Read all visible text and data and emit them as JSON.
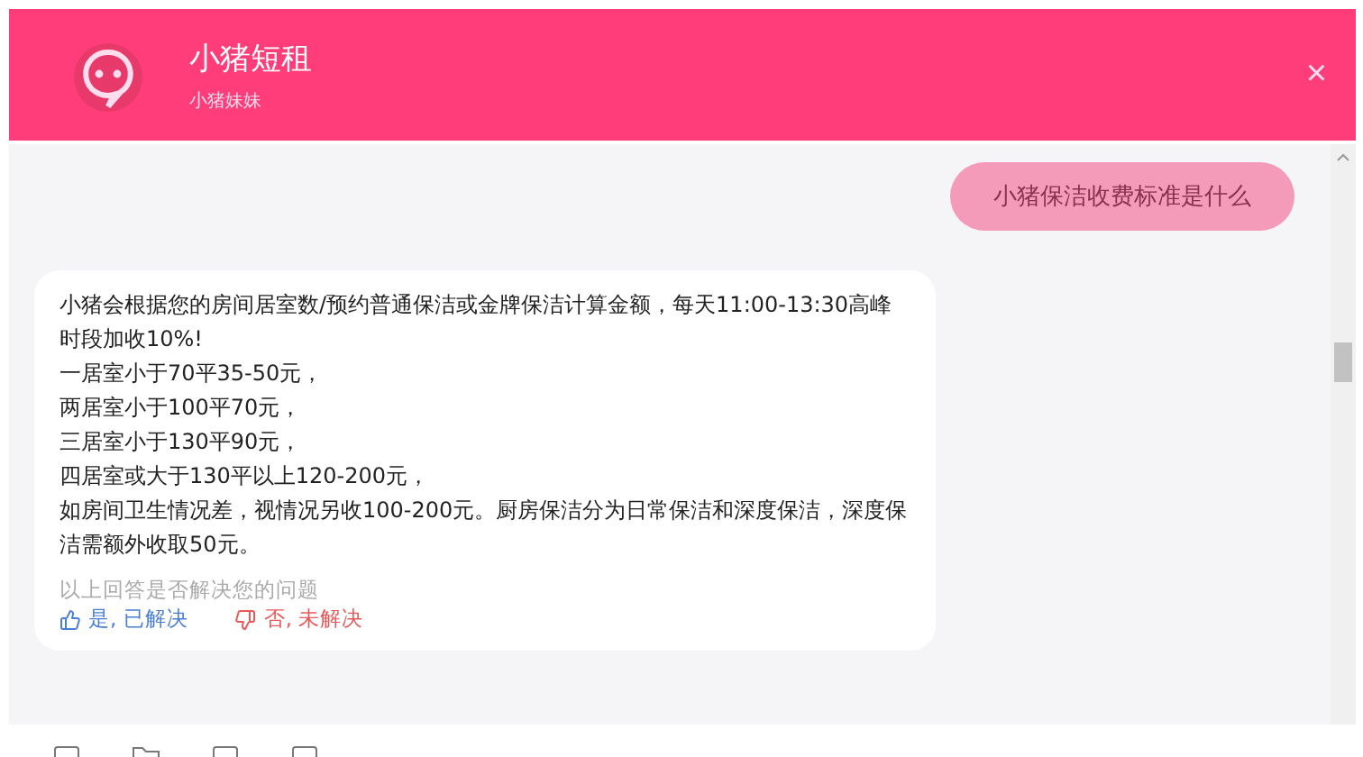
{
  "header": {
    "title": "小猪短租",
    "subtitle": "小猪妹妹",
    "close": "×"
  },
  "messages": [
    {
      "kind": "user",
      "text": "小猪保洁收费标准是什么"
    },
    {
      "kind": "bot",
      "paragraphs": [
        "小猪会根据您的房间居室数/预约普通保洁或金牌保洁计算金额，每天11:00-13:30高峰时段加收10%!",
        "一居室小于70平35-50元，",
        "两居室小于100平70元，",
        "三居室小于130平90元，",
        "四居室或大于130平以上120-200元，",
        "如房间卫生情况差，视情况另收100-200元。厨房保洁分为日常保洁和深度保洁，深度保洁需额外收取50元。"
      ],
      "feedback_question": "以上回答是否解决您的问题",
      "feedback": [
        {
          "kind": "yes",
          "label": "是, 已解决"
        },
        {
          "kind": "no",
          "label": "否, 未解决"
        }
      ]
    }
  ]
}
